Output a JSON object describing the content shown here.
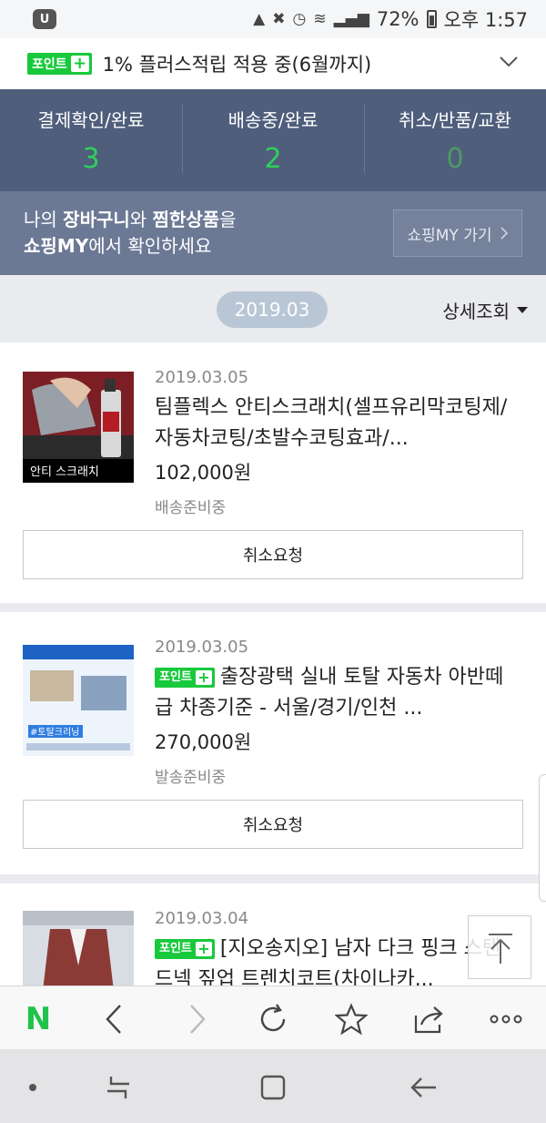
{
  "status_bar": {
    "left_icon": "U",
    "battery": "72%",
    "time": "오후 1:57"
  },
  "point_banner": {
    "badge": "포인트",
    "badge_plus": "+",
    "text": "1% 플러스적립 적용 중(6월까지)"
  },
  "order_status": [
    {
      "label": "결제확인/완료",
      "count": "3"
    },
    {
      "label": "배송중/완료",
      "count": "2"
    },
    {
      "label": "취소/반품/교환",
      "count": "0"
    }
  ],
  "my_panel": {
    "line1_a": "나의 ",
    "line1_b": "장바구니",
    "line1_c": "와 ",
    "line1_d": "찜한상품",
    "line1_e": "을",
    "line2_a": "쇼핑MY",
    "line2_b": "에서 확인하세요",
    "button": "쇼핑MY 가기"
  },
  "month": {
    "label": "2019.03",
    "detail": "상세조회"
  },
  "orders": [
    {
      "date": "2019.03.05",
      "title": "팀플렉스 안티스크래치(셀프유리막코팅제/자동차코팅/초발수코팅효과/...",
      "price": "102,000원",
      "state": "배송준비중",
      "cancel": "취소요청",
      "thumb_caption": "안티 스크래치"
    },
    {
      "date": "2019.03.05",
      "title": "출장광택 실내 토탈 자동차 아반떼급 차종기준 - 서울/경기/인천 ...",
      "price": "270,000원",
      "state": "발송준비중",
      "cancel": "취소요청",
      "thumb_caption": "#토탈크리닝"
    },
    {
      "date": "2019.03.04",
      "title": "[지오송지오] 남자 다크 핑크 스탠드넥 짚업 트렌치코트(차이나카..."
    }
  ],
  "icons": {
    "browser": [
      "naver-logo",
      "back-icon",
      "forward-icon",
      "refresh-icon",
      "bookmark-star-icon",
      "share-icon",
      "more-icon"
    ],
    "nav": [
      "dot-icon",
      "recent-apps-icon",
      "home-icon",
      "back-nav-icon"
    ]
  },
  "colors": {
    "point_green": "#19c93c",
    "panel_bg": "#4f5e7b",
    "count_green": "#2ed15c"
  }
}
